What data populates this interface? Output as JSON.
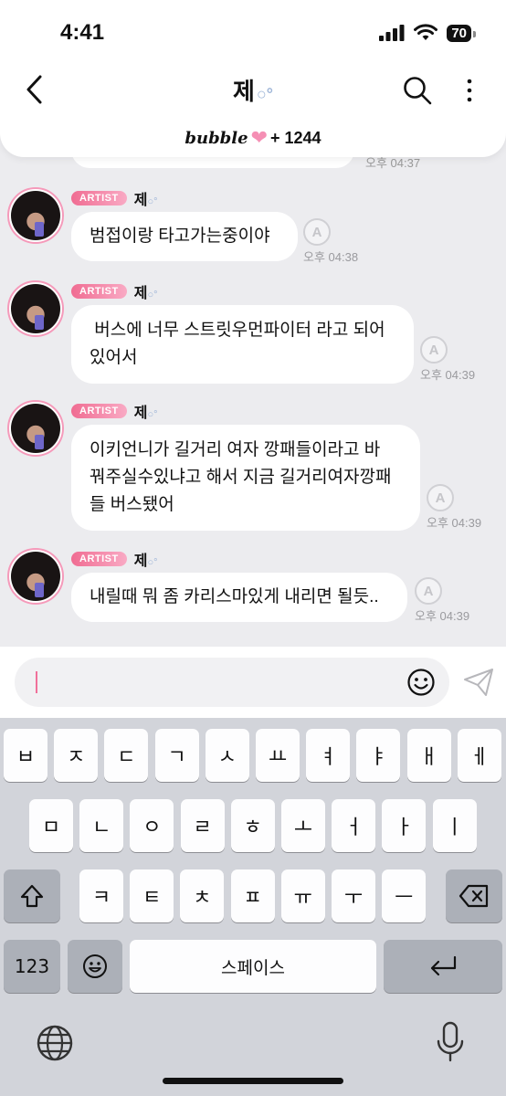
{
  "status": {
    "time": "4:41",
    "battery": "70"
  },
  "header": {
    "title": "제",
    "title_bubbles": "○°",
    "brand": "bubble",
    "subscriber_count": "+ 1244"
  },
  "previous_time": "오후 04:37",
  "messages": [
    {
      "badge": "ARTIST",
      "sender": "제",
      "sender_bubbles": "○°",
      "lines": [
        "범접이랑 타고가는중이야"
      ],
      "time": "오후 04:38"
    },
    {
      "badge": "ARTIST",
      "sender": "제",
      "sender_bubbles": "○°",
      "lines": [
        " 버스에 너무 스트릿우먼파이터 라고 되어",
        "있어서"
      ],
      "time": "오후 04:39"
    },
    {
      "badge": "ARTIST",
      "sender": "제",
      "sender_bubbles": "○°",
      "lines": [
        "이키언니가 길거리 여자 깡패들이라고 바",
        "꿔주실수있냐고 해서 지금 길거리여자깡패",
        "들 버스됐어"
      ],
      "time": "오후 04:39"
    },
    {
      "badge": "ARTIST",
      "sender": "제",
      "sender_bubbles": "○°",
      "lines": [
        "내릴때 뭐 좀 카리스마있게 내리면 될듯.."
      ],
      "time": "오후 04:39"
    }
  ],
  "translate_icon_glyph": "A",
  "input": {
    "placeholder": ""
  },
  "keyboard": {
    "row1": [
      "ㅂ",
      "ㅈ",
      "ㄷ",
      "ㄱ",
      "ㅅ",
      "ㅛ",
      "ㅕ",
      "ㅑ",
      "ㅐ",
      "ㅔ"
    ],
    "row2": [
      "ㅁ",
      "ㄴ",
      "ㅇ",
      "ㄹ",
      "ㅎ",
      "ㅗ",
      "ㅓ",
      "ㅏ",
      "ㅣ"
    ],
    "row3": [
      "ㅋ",
      "ㅌ",
      "ㅊ",
      "ㅍ",
      "ㅠ",
      "ㅜ",
      "ㅡ"
    ],
    "numbers_label": "123",
    "space_label": "스페이스"
  },
  "icons": [
    "back-icon",
    "search-icon",
    "more-icon",
    "translate-icon",
    "emoji-icon",
    "send-icon",
    "shift-icon",
    "delete-icon",
    "return-icon",
    "globe-icon",
    "microphone-icon"
  ],
  "colors": {
    "accent_pink": "#f0709a",
    "badge_pink": "#f06c92",
    "chat_bg": "#ececef",
    "keyboard_bg": "#d2d4da"
  }
}
